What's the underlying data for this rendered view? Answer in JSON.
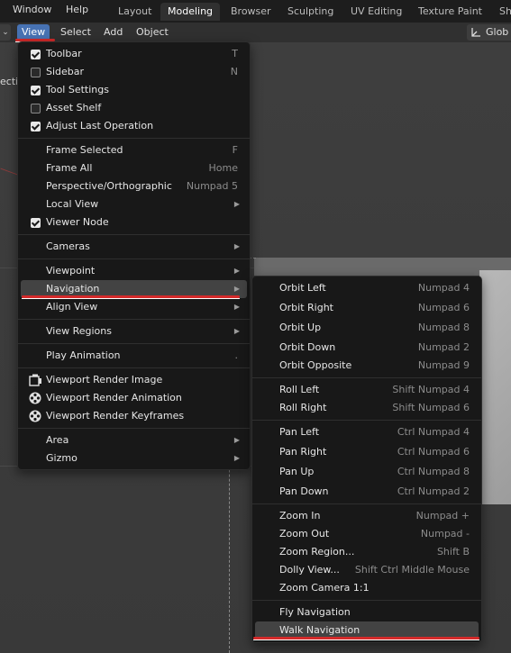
{
  "topbar": {
    "menus": [
      "Window",
      "Help"
    ],
    "workspaces": [
      "Layout",
      "Modeling",
      "Browser",
      "Sculpting",
      "UV Editing",
      "Texture Paint",
      "Sh"
    ],
    "active_workspace": "Modeling"
  },
  "header": {
    "menus": [
      "View",
      "Select",
      "Add",
      "Object"
    ],
    "orientation": "Glob"
  },
  "viewport": {
    "overlay_text": "ecti"
  },
  "view_menu": {
    "items": [
      {
        "label": "Toolbar",
        "shortcut": "T",
        "check": true
      },
      {
        "label": "Sidebar",
        "shortcut": "N",
        "check": false
      },
      {
        "label": "Tool Settings",
        "shortcut": "",
        "check": true
      },
      {
        "label": "Asset Shelf",
        "shortcut": "",
        "check": false
      },
      {
        "label": "Adjust Last Operation",
        "shortcut": "",
        "check": true
      },
      {
        "label": "Frame Selected",
        "shortcut": "F"
      },
      {
        "label": "Frame All",
        "shortcut": "Home"
      },
      {
        "label": "Perspective/Orthographic",
        "shortcut": "Numpad 5"
      },
      {
        "label": "Local View",
        "submenu": true
      },
      {
        "label": "Viewer Node",
        "check": true
      },
      {
        "label": "Cameras",
        "submenu": true
      },
      {
        "label": "Viewpoint",
        "submenu": true
      },
      {
        "label": "Navigation",
        "submenu": true
      },
      {
        "label": "Align View",
        "submenu": true
      },
      {
        "label": "View Regions",
        "submenu": true
      },
      {
        "label": "Play Animation",
        "shortcut": "."
      },
      {
        "label": "Viewport Render Image"
      },
      {
        "label": "Viewport Render Animation"
      },
      {
        "label": "Viewport Render Keyframes"
      },
      {
        "label": "Area",
        "submenu": true
      },
      {
        "label": "Gizmo",
        "submenu": true
      }
    ]
  },
  "navigation_menu": {
    "items": [
      {
        "label": "Orbit Left",
        "shortcut": "Numpad 4"
      },
      {
        "label": "Orbit Right",
        "shortcut": "Numpad 6"
      },
      {
        "label": "Orbit Up",
        "shortcut": "Numpad 8"
      },
      {
        "label": "Orbit Down",
        "shortcut": "Numpad 2"
      },
      {
        "label": "Orbit Opposite",
        "shortcut": "Numpad 9"
      },
      {
        "label": "Roll Left",
        "shortcut": "Shift Numpad 4"
      },
      {
        "label": "Roll Right",
        "shortcut": "Shift Numpad 6"
      },
      {
        "label": "Pan Left",
        "shortcut": "Ctrl Numpad 4"
      },
      {
        "label": "Pan Right",
        "shortcut": "Ctrl Numpad 6"
      },
      {
        "label": "Pan Up",
        "shortcut": "Ctrl Numpad 8"
      },
      {
        "label": "Pan Down",
        "shortcut": "Ctrl Numpad 2"
      },
      {
        "label": "Zoom In",
        "shortcut": "Numpad +"
      },
      {
        "label": "Zoom Out",
        "shortcut": "Numpad -"
      },
      {
        "label": "Zoom Region...",
        "shortcut": "Shift B"
      },
      {
        "label": "Dolly View...",
        "shortcut": "Shift Ctrl Middle Mouse"
      },
      {
        "label": "Zoom Camera 1:1",
        "shortcut": ""
      },
      {
        "label": "Fly Navigation",
        "shortcut": ""
      },
      {
        "label": "Walk Navigation",
        "shortcut": ""
      }
    ]
  },
  "colors": {
    "accent": "#4772b3",
    "highlight": "#434343",
    "annotation": "#d42a2a"
  }
}
